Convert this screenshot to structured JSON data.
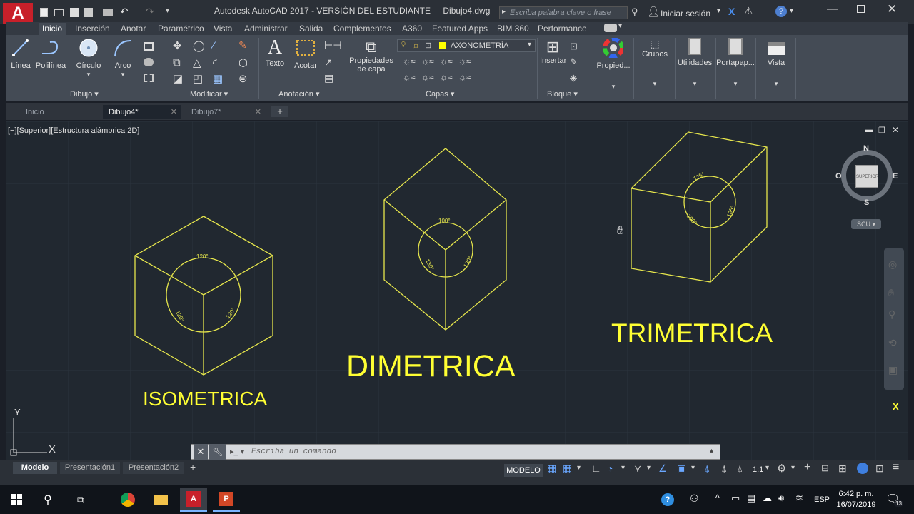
{
  "titlebar": {
    "title": "Autodesk AutoCAD 2017 - VERSIÓN DEL ESTUDIANTE",
    "file": "Dibujo4.dwg",
    "search_placeholder": "Escriba palabra clave o frase",
    "signin": "Iniciar sesión"
  },
  "ribbon_tabs": [
    "Inicio",
    "Inserción",
    "Anotar",
    "Paramétrico",
    "Vista",
    "Administrar",
    "Salida",
    "Complementos",
    "A360",
    "Featured Apps",
    "BIM 360",
    "Performance"
  ],
  "ribbon": {
    "linea": "Línea",
    "polilinea": "Polilínea",
    "circulo": "Círculo",
    "arco": "Arco",
    "texto": "Texto",
    "acotar": "Acotar",
    "propiedades_capa_1": "Propiedades",
    "propiedades_capa_2": "de capa",
    "layer_name": "AXONOMETRÍA",
    "insertar": "Insertar",
    "propied": "Propied...",
    "grupos": "Grupos",
    "utilidades": "Utilidades",
    "portapap": "Portapap...",
    "vista": "Vista",
    "groups": {
      "dibujo": "Dibujo",
      "modificar": "Modificar",
      "anotacion": "Anotación",
      "capas": "Capas",
      "bloque": "Bloque"
    }
  },
  "doc_tabs": [
    "Inicio",
    "Dibujo4*",
    "Dibujo7*"
  ],
  "viewport_label": "[−][Superior][Estructura alámbrica 2D]",
  "viewcube": {
    "n": "N",
    "s": "S",
    "e": "E",
    "o": "O",
    "face": "SUPERIOR",
    "ucs": "SCU"
  },
  "drawings": {
    "iso_label": "ISOMETRICA",
    "iso_angles": [
      "120°",
      "120°",
      "120°"
    ],
    "dim_label": "DIMETRICA",
    "dim_angles": [
      "100°",
      "130°",
      "130°"
    ],
    "tri_label": "TRIMETRICA",
    "tri_angles": [
      "125°",
      "100°",
      "135°"
    ]
  },
  "axis": {
    "y": "Y",
    "x": "X"
  },
  "command_placeholder": "Escriba un comando",
  "layout_tabs": [
    "Modelo",
    "Presentación1",
    "Presentación2"
  ],
  "status": {
    "modelo": "MODELO",
    "scale": "1:1"
  },
  "taskbar": {
    "time": "6:42 p. m.",
    "date": "16/07/2019",
    "lang": "ESP",
    "notif": "13"
  },
  "colors": {
    "drawing": "#e6e64c",
    "label": "#ffff33",
    "bg": "#212830"
  }
}
